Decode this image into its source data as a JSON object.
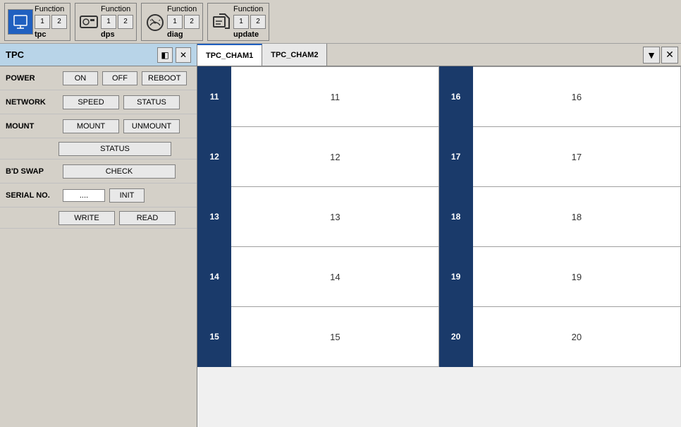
{
  "toolbar": {
    "groups": [
      {
        "id": "tpc",
        "icon_label": "TPC",
        "func_label": "Function",
        "buttons": [
          "1",
          "2"
        ],
        "icon_type": "yellow"
      },
      {
        "id": "dps",
        "icon_label": "DPS",
        "func_label": "Function",
        "buttons": [
          "1",
          "2"
        ],
        "icon_type": "camera"
      },
      {
        "id": "diag",
        "icon_label": "DIAG",
        "func_label": "Function",
        "buttons": [
          "1",
          "2"
        ],
        "icon_type": "gauge"
      },
      {
        "id": "update",
        "icon_label": "UPDATE",
        "func_label": "Function",
        "buttons": [
          "1",
          "2"
        ],
        "icon_type": "folder"
      }
    ]
  },
  "left_panel": {
    "title": "TPC",
    "header_buttons": [
      "pin",
      "close"
    ],
    "sections": [
      {
        "label": "POWER",
        "buttons": [
          "ON",
          "OFF",
          "REBOOT"
        ],
        "type": "buttons"
      },
      {
        "label": "NETWORK",
        "buttons": [
          "SPEED",
          "STATUS"
        ],
        "type": "buttons"
      },
      {
        "label": "MOUNT",
        "buttons": [
          "MOUNT",
          "UNMOUNT"
        ],
        "type": "buttons"
      },
      {
        "label": "",
        "buttons": [
          "STATUS"
        ],
        "type": "sub-buttons"
      },
      {
        "label": "B'D SWAP",
        "buttons": [
          "CHECK"
        ],
        "type": "buttons"
      },
      {
        "label": "SERIAL NO.",
        "input_placeholder": "....",
        "buttons": [
          "INIT"
        ],
        "type": "input-buttons"
      },
      {
        "label": "",
        "buttons": [
          "WRITE",
          "READ"
        ],
        "type": "sub-buttons"
      }
    ]
  },
  "right_panel": {
    "tabs": [
      "TPC_CHAM1",
      "TPC_CHAM2"
    ],
    "active_tab": 0,
    "grid": {
      "rows": [
        {
          "left_num": 11,
          "left_val": 11,
          "right_num": 16,
          "right_val": 16
        },
        {
          "left_num": 12,
          "left_val": 12,
          "right_num": 17,
          "right_val": 17
        },
        {
          "left_num": 13,
          "left_val": 13,
          "right_num": 18,
          "right_val": 18
        },
        {
          "left_num": 14,
          "left_val": 14,
          "right_num": 19,
          "right_val": 19
        },
        {
          "left_num": 15,
          "left_val": 15,
          "right_num": 20,
          "right_val": 20
        }
      ]
    }
  }
}
